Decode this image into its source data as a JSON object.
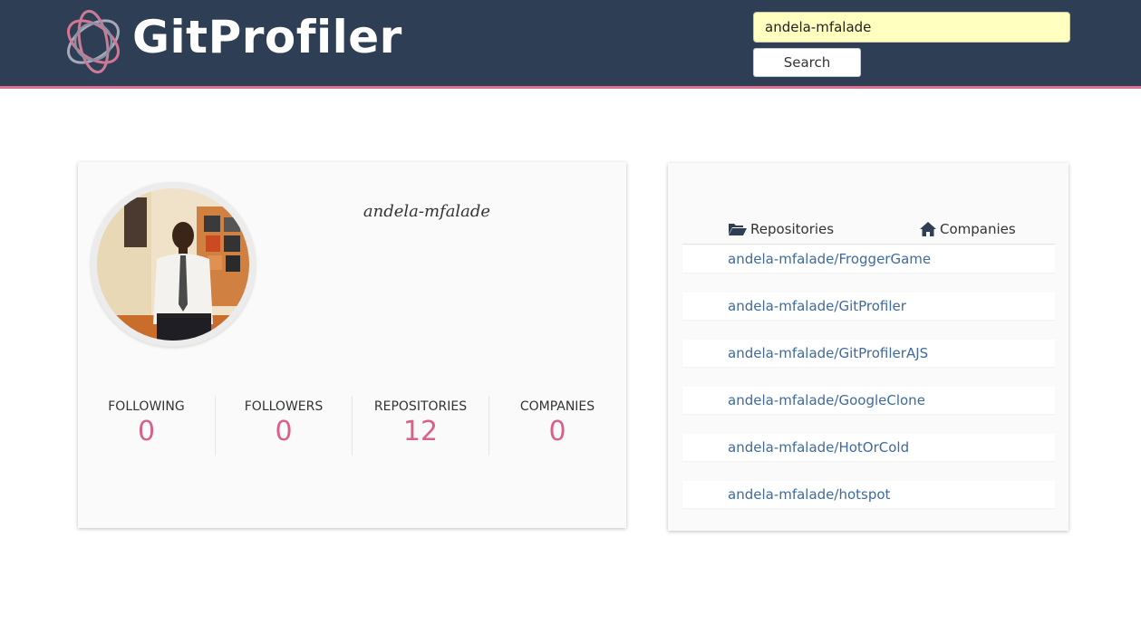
{
  "brand": {
    "name": "GitProfiler"
  },
  "search": {
    "value": "andela-mfalade",
    "button_label": "Search"
  },
  "profile": {
    "username": "andela-mfalade",
    "stats": [
      {
        "label": "FOLLOWING",
        "value": "0"
      },
      {
        "label": "FOLLOWERS",
        "value": "0"
      },
      {
        "label": "REPOSITORIES",
        "value": "12"
      },
      {
        "label": "COMPANIES",
        "value": "0"
      }
    ]
  },
  "tabs": {
    "repositories": "Repositories",
    "companies": "Companies"
  },
  "repos": [
    "andela-mfalade/FroggerGame",
    "andela-mfalade/GitProfiler",
    "andela-mfalade/GitProfilerAJS",
    "andela-mfalade/GoogleClone",
    "andela-mfalade/HotOrCold",
    "andela-mfalade/hotspot"
  ],
  "colors": {
    "header": "#2e3e54",
    "accent": "#d9738f",
    "stat_value": "#d9608a",
    "link": "#3d6a9f",
    "search_bg": "#ffffc0"
  },
  "icons": {
    "logo": "orbit-logo-icon",
    "repositories": "folder-open-icon",
    "companies": "home-icon"
  }
}
